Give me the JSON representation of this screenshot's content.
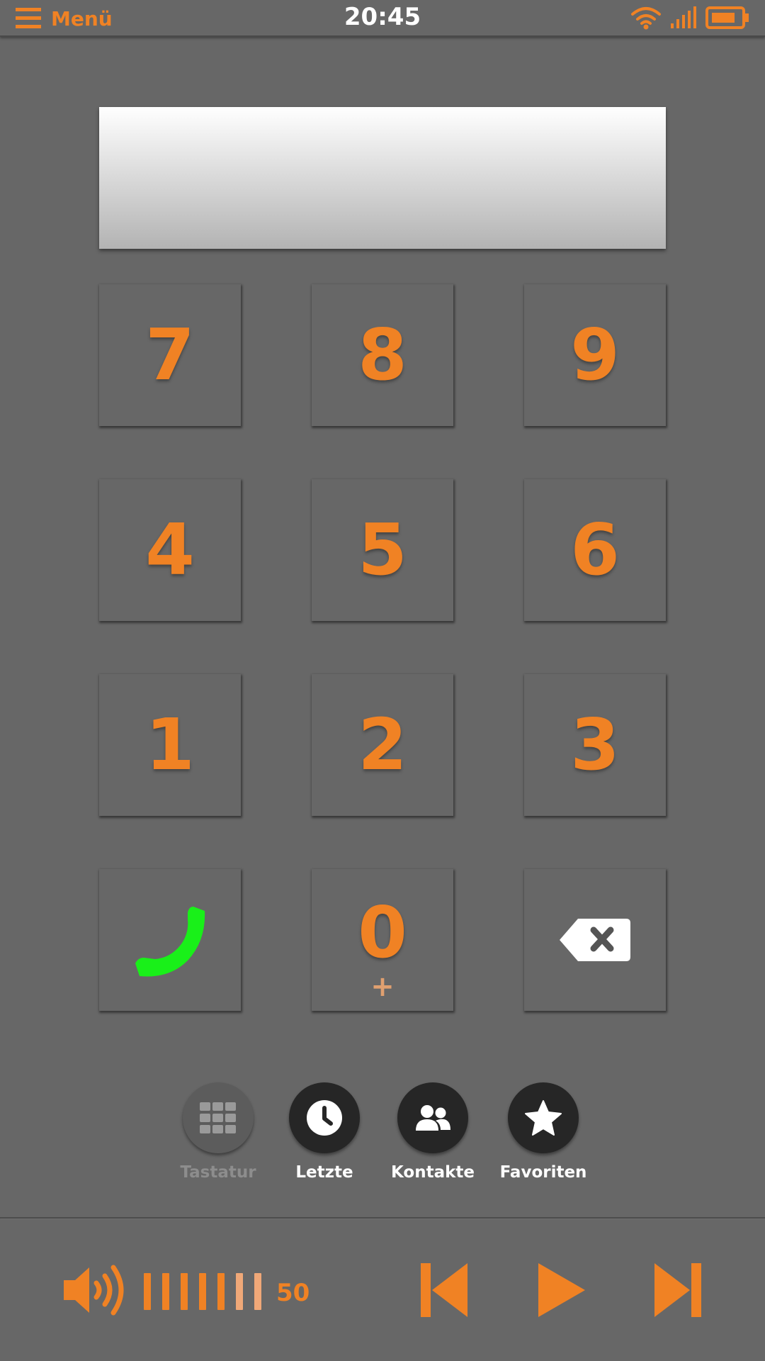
{
  "status_bar": {
    "menu_label": "Menü",
    "time": "20:45",
    "icons": [
      "wifi-icon",
      "signal-icon",
      "battery-icon"
    ]
  },
  "display": {
    "value": ""
  },
  "keypad": {
    "rows": [
      [
        "7",
        "8",
        "9"
      ],
      [
        "4",
        "5",
        "6"
      ],
      [
        "1",
        "2",
        "3"
      ]
    ],
    "zero": {
      "digit": "0",
      "sub": "+"
    },
    "call_icon": "phone-icon",
    "backspace_icon": "backspace-icon"
  },
  "nav": {
    "items": [
      {
        "label": "Tastatur",
        "icon": "keypad-grid-icon",
        "active": true
      },
      {
        "label": "Letzte",
        "icon": "clock-icon",
        "active": false
      },
      {
        "label": "Kontakte",
        "icon": "contacts-icon",
        "active": false
      },
      {
        "label": "Favoriten",
        "icon": "star-icon",
        "active": false
      }
    ]
  },
  "media": {
    "volume_value": "50",
    "volume_bars_total": 7,
    "volume_bars_full": 5,
    "controls": [
      "previous-icon",
      "play-icon",
      "next-icon"
    ]
  },
  "colors": {
    "background": "#676767",
    "accent": "#f08224",
    "call_green": "#19f019",
    "nav_circle": "#262626"
  }
}
